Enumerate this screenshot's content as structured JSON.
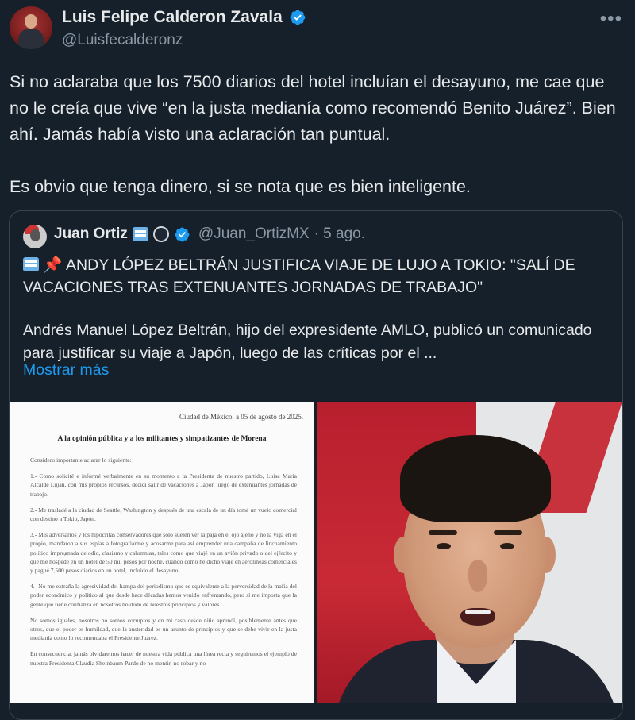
{
  "tweet": {
    "author_name": "Luis Felipe Calderon Zavala",
    "author_handle": "@Luisfecalderonz",
    "text_p1": "Si no aclaraba que los 7500 diarios del hotel incluían el desayuno, me cae que no le creía que vive “en la justa medianía como recomendó Benito Juárez”. Bien ahí. Jamás había visto una aclaración tan puntual.",
    "text_p2": "Es obvio que tenga dinero, si se nota que es bien inteligente.",
    "more_icon": "•••"
  },
  "quote": {
    "author_name": "Juan Ortiz",
    "author_handle": "@Juan_OrtizMX",
    "time": "· 5 ago.",
    "title": "ANDY LÓPEZ BELTRÁN JUSTIFICA VIAJE DE LUJO A TOKIO: \"SALÍ DE VACACIONES TRAS EXTENUANTES JORNADAS DE TRABAJO\"",
    "body": "Andrés Manuel López Beltrán, hijo del expresidente AMLO, publicó un comunicado para justificar su viaje a Japón, luego de las críticas por el ...",
    "show_more": "Mostrar más"
  },
  "document": {
    "date": "Ciudad de México, a 05 de agosto de 2025.",
    "heading": "A la opinión pública y a los militantes y simpatizantes de Morena",
    "p0": "Considero importante aclarar lo siguiente:",
    "p1": "1.- Como solicité e informé verbalmente en su momento a la Presidenta de nuestro partido, Luisa María Alcalde Luján, con mis propios recursos, decidí salir de vacaciones a Japón luego de extenuantes jornadas de trabajo.",
    "p2": "2.- Me trasladé a la ciudad de Seattle, Washington y después de una escala de un día tomé un vuelo comercial con destino a Tokio, Japón.",
    "p3": "3.- Mis adversarios y los hipócritas conservadores que solo suelen ver la paja en el ojo ajeno y no la viga en el propio, mandaron a sus espías a fotografiarme y acosarme para así emprender una campaña de linchamiento político impregnada de odio, clasismo y calumnias, tales como que viajé en un avión privado o del ejército y que me hospedé en un hotel de 50 mil pesos por noche, cuando como he dicho viajé en aerolíneas comerciales y pagué 7,500 pesos diarios en un hotel, incluido el desayuno.",
    "p4": "4.- No me extraña la agresividad del hampa del periodismo que es equivalente a la perversidad de la mafia del poder económico y político al que desde hace décadas hemos venido enfrentando, pero sí me importa que la gente que tiene confianza en nosotros no dude de nuestros principios y valores.",
    "p5": "No somos iguales, nosotros no somos corruptos y en mi caso desde niño aprendí, posiblemente antes que otros, que el poder es humildad, que la austeridad es un asunto de principios y que se debe vivir en la justa medianía como lo recomendaba el Presidente Juárez.",
    "p6": "En consecuencia, jamás olvidaremos hacer de nuestra vida pública una línea recta y seguiremos el ejemplo de nuestra Presidenta Claudia Sheinbaum Pardo de no mentir, no robar y no"
  },
  "colors": {
    "background": "#15202b",
    "text": "#e7e9ea",
    "secondary": "#8b98a5",
    "link": "#1d9bf0",
    "verified": "#1d9bf0",
    "border": "#38444d"
  }
}
